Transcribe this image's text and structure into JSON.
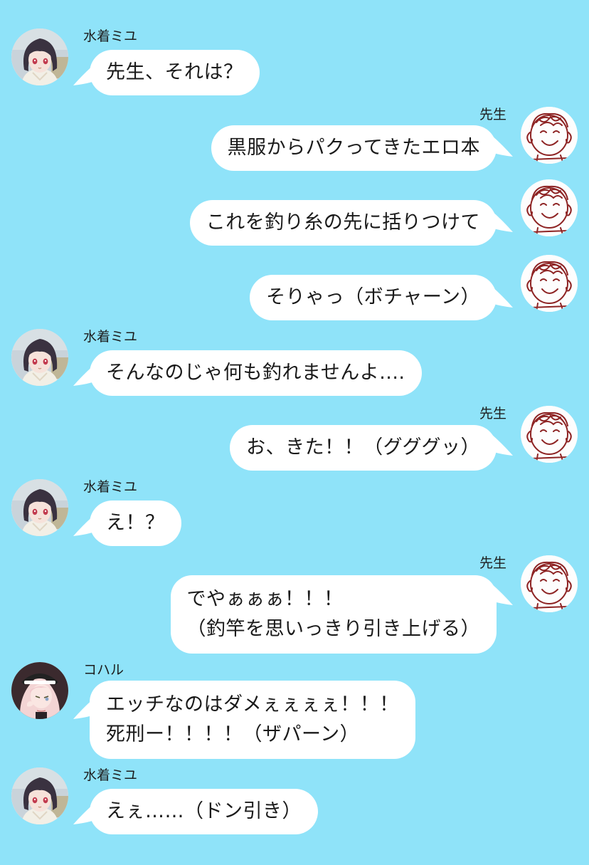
{
  "messages": [
    {
      "side": "left",
      "avatar": "miyu",
      "name": "水着ミユ",
      "lines": [
        "先生、それは？"
      ]
    },
    {
      "side": "right",
      "avatar": "sensei",
      "name": "先生",
      "lines": [
        "黒服からパクってきたエロ本"
      ]
    },
    {
      "side": "right",
      "avatar": "sensei",
      "name": "",
      "lines": [
        "これを釣り糸の先に括りつけて"
      ]
    },
    {
      "side": "right",
      "avatar": "sensei",
      "name": "",
      "lines": [
        "そりゃっ（ボチャーン）"
      ]
    },
    {
      "side": "left",
      "avatar": "miyu",
      "name": "水着ミユ",
      "lines": [
        "そんなのじゃ何も釣れませんよ...."
      ]
    },
    {
      "side": "right",
      "avatar": "sensei",
      "name": "先生",
      "lines": [
        "お、きた！！（グググッ）"
      ]
    },
    {
      "side": "left",
      "avatar": "miyu",
      "name": "水着ミユ",
      "lines": [
        "え！？"
      ]
    },
    {
      "side": "right",
      "avatar": "sensei",
      "name": "先生",
      "lines": [
        "でやぁぁぁ！！！",
        "（釣竿を思いっきり引き上げる）"
      ]
    },
    {
      "side": "left",
      "avatar": "koharu",
      "name": "コハル",
      "lines": [
        "エッチなのはダメぇぇぇぇ！！！",
        "死刑ー！！！！（ザパーン）"
      ]
    },
    {
      "side": "left",
      "avatar": "miyu",
      "name": "水着ミユ",
      "lines": [
        "えぇ……（ドン引き）"
      ]
    }
  ],
  "colors": {
    "background": "#8fe3f9",
    "bubble": "#ffffff",
    "text": "#1a1a1a"
  }
}
